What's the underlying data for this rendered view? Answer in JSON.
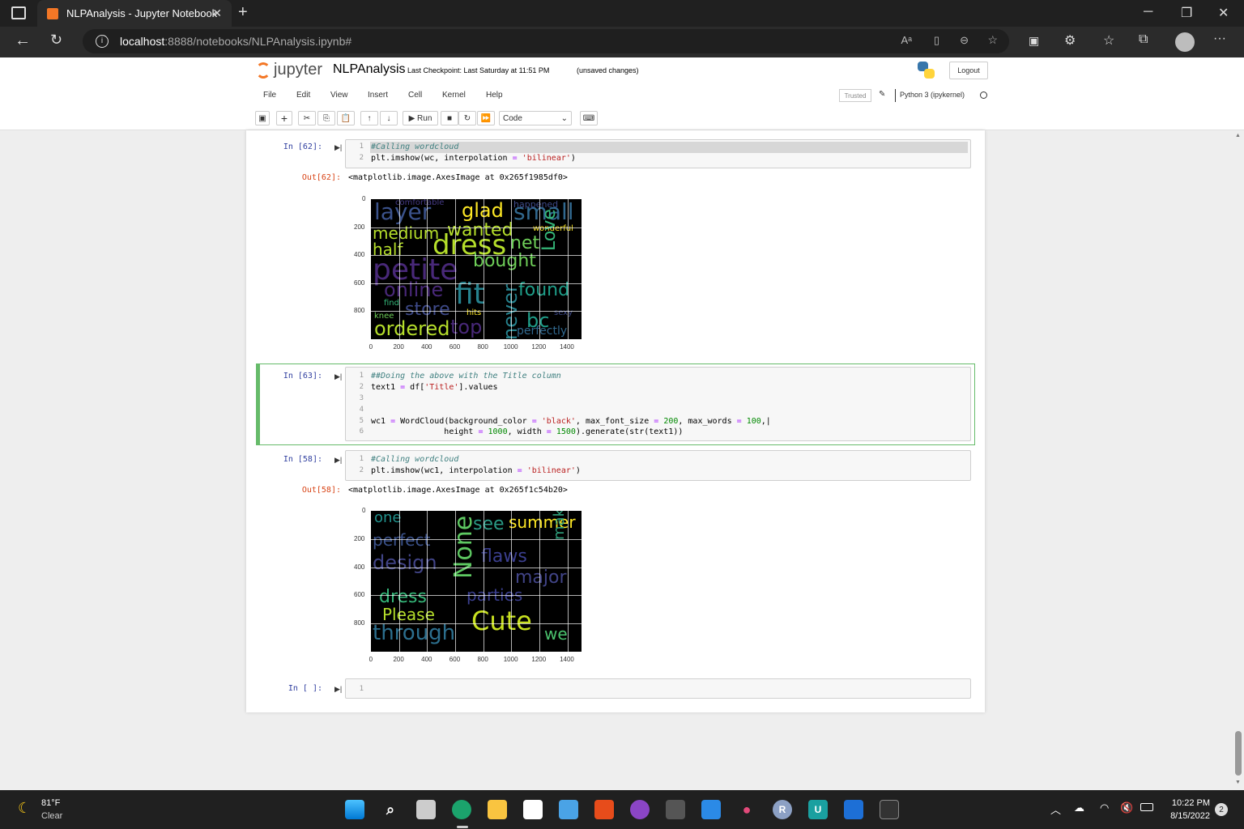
{
  "browser": {
    "tab_title": "NLPAnalysis - Jupyter Notebook",
    "url_host": "localhost",
    "url_rest": ":8888/notebooks/NLPAnalysis.ipynb#"
  },
  "jupyter": {
    "logo_text": "jupyter",
    "notebook_name": "NLPAnalysis",
    "checkpoint": "Last Checkpoint: Last Saturday at 11:51 PM",
    "unsaved": "(unsaved changes)",
    "logout": "Logout",
    "menu": [
      "File",
      "Edit",
      "View",
      "Insert",
      "Cell",
      "Kernel",
      "Help"
    ],
    "trusted": "Trusted",
    "kernel": "Python 3 (ipykernel)",
    "run_label": "Run",
    "cell_type": "Code"
  },
  "cells": {
    "c62": {
      "prompt": "In [62]:",
      "lines": [
        "#Calling wordcloud",
        "plt.imshow(wc, interpolation = 'bilinear')"
      ],
      "out_prompt": "Out[62]:",
      "out_text": "<matplotlib.image.AxesImage at 0x265f1985df0>"
    },
    "c63": {
      "prompt": "In [63]:",
      "lines": [
        "##Doing the above with the Title column",
        "text1 = df['Title'].values",
        "",
        "",
        "wc1 = WordCloud(background_color = 'black', max_font_size = 200, max_words = 100,",
        "               height = 1000, width = 1500).generate(str(text1))"
      ]
    },
    "c58": {
      "prompt": "In [58]:",
      "lines": [
        "#Calling wordcloud",
        "plt.imshow(wc1, interpolation = 'bilinear')"
      ],
      "out_prompt": "Out[58]:",
      "out_text": "<matplotlib.image.AxesImage at 0x265f1c54b20>"
    },
    "cempty": {
      "prompt": "In [ ]:"
    }
  },
  "plot_ticks": {
    "x": [
      "0",
      "200",
      "400",
      "600",
      "800",
      "1000",
      "1200",
      "1400"
    ],
    "y": [
      "0",
      "200",
      "400",
      "600",
      "800"
    ]
  },
  "wordcloud1": [
    {
      "t": "layer",
      "c": "#3b528b",
      "s": 28
    },
    {
      "t": "glad",
      "c": "#fde725",
      "s": 24
    },
    {
      "t": "small",
      "c": "#31688e",
      "s": 28
    },
    {
      "t": "medium",
      "c": "#b5de2b",
      "s": 20
    },
    {
      "t": "wanted",
      "c": "#b5de2b",
      "s": 22
    },
    {
      "t": "wonderful",
      "c": "#fde725",
      "s": 10
    },
    {
      "t": "half",
      "c": "#b5de2b",
      "s": 20
    },
    {
      "t": "dress",
      "c": "#b5de2b",
      "s": 34
    },
    {
      "t": "net",
      "c": "#6ece58",
      "s": 22
    },
    {
      "t": "petite",
      "c": "#482878",
      "s": 36
    },
    {
      "t": "bought",
      "c": "#6ece58",
      "s": 22
    },
    {
      "t": "Love",
      "c": "#35b779",
      "s": 22
    },
    {
      "t": "online",
      "c": "#482878",
      "s": 24
    },
    {
      "t": "fit",
      "c": "#26828e",
      "s": 36
    },
    {
      "t": "found",
      "c": "#1f9e89",
      "s": 22
    },
    {
      "t": "store",
      "c": "#3e4a89",
      "s": 22
    },
    {
      "t": "never",
      "c": "#26828e",
      "s": 24
    },
    {
      "t": "ordered",
      "c": "#b5de2b",
      "s": 24
    },
    {
      "t": "top",
      "c": "#482878",
      "s": 24
    },
    {
      "t": "bc",
      "c": "#1f9e89",
      "s": 24
    },
    {
      "t": "perfectly",
      "c": "#31688e",
      "s": 14
    },
    {
      "t": "comfortable",
      "c": "#443983",
      "s": 10
    },
    {
      "t": "happened",
      "c": "#3e4a89",
      "s": 11
    },
    {
      "t": "knee",
      "c": "#6ece58",
      "s": 10
    },
    {
      "t": "hits",
      "c": "#fde725",
      "s": 10
    },
    {
      "t": "sexy",
      "c": "#3e4a89",
      "s": 10
    },
    {
      "t": "find",
      "c": "#35b779",
      "s": 10
    }
  ],
  "wordcloud2": [
    {
      "t": "one",
      "c": "#21918c",
      "s": 18
    },
    {
      "t": "see",
      "c": "#2a9a85",
      "s": 22
    },
    {
      "t": "summer",
      "c": "#fde725",
      "s": 20
    },
    {
      "t": "perfect",
      "c": "#3b528b",
      "s": 20
    },
    {
      "t": "design",
      "c": "#414487",
      "s": 24
    },
    {
      "t": "flaws",
      "c": "#3b3f8f",
      "s": 22
    },
    {
      "t": "make",
      "c": "#2fa17d",
      "s": 18
    },
    {
      "t": "None",
      "c": "#5ec962",
      "s": 30
    },
    {
      "t": "major",
      "c": "#414487",
      "s": 22
    },
    {
      "t": "dress",
      "c": "#35b779",
      "s": 22
    },
    {
      "t": "parties",
      "c": "#3b3f8f",
      "s": 20
    },
    {
      "t": "Please",
      "c": "#b5de2b",
      "s": 20
    },
    {
      "t": "Cute",
      "c": "#c8e020",
      "s": 32
    },
    {
      "t": "through",
      "c": "#2c6f8e",
      "s": 26
    },
    {
      "t": "we",
      "c": "#4ac16d",
      "s": 20
    }
  ],
  "taskbar": {
    "weather_temp": "81°F",
    "weather_cond": "Clear",
    "time": "10:22 PM",
    "date": "8/15/2022",
    "badge": "2"
  },
  "colors": {
    "accent": "#f37726",
    "selected_border": "#66bb6a",
    "prompt": "#303f9f",
    "out_prompt": "#d84315"
  }
}
